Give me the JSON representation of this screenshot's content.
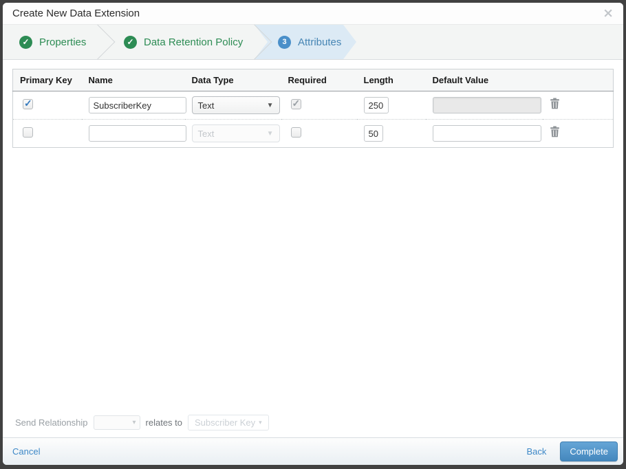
{
  "modal": {
    "title": "Create New Data Extension",
    "close_icon": "×"
  },
  "steps": {
    "step1": {
      "label": "Properties",
      "state": "complete"
    },
    "step2": {
      "label": "Data Retention Policy",
      "state": "complete"
    },
    "step3": {
      "label": "Attributes",
      "number": "3",
      "state": "active"
    }
  },
  "attributes_table": {
    "headers": {
      "primary_key": "Primary Key",
      "name": "Name",
      "data_type": "Data Type",
      "required": "Required",
      "length": "Length",
      "default_value": "Default Value"
    },
    "rows": [
      {
        "primary_key_checked": true,
        "name": "SubscriberKey",
        "data_type": "Text",
        "required_checked": true,
        "length": "250",
        "default_value": ""
      },
      {
        "primary_key_checked": false,
        "name": "",
        "data_type": "Text",
        "required_checked": false,
        "length": "50",
        "default_value": ""
      }
    ]
  },
  "send_relationship": {
    "label": "Send Relationship",
    "relates_to": "relates to",
    "value": "Subscriber Key",
    "dropdown_arrow": "▾"
  },
  "footer": {
    "cancel": "Cancel",
    "back": "Back",
    "complete": "Complete"
  },
  "colors": {
    "step_complete_green": "#2d8c54",
    "step_active_blue": "#4685b4",
    "step_active_bg": "#dceaf5",
    "link_blue": "#3d88c7",
    "complete_button": "#4487bd",
    "primary_check_blue": "#3579bd"
  }
}
